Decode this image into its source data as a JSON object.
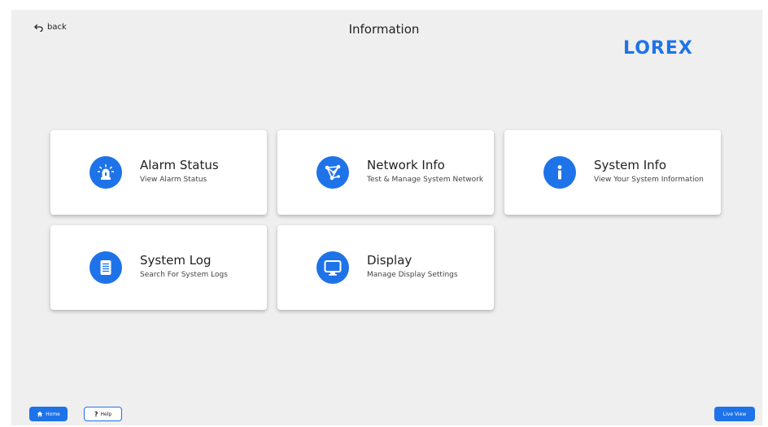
{
  "header": {
    "back_label": "back",
    "title": "Information",
    "logo_text": "LOREX"
  },
  "cards": [
    {
      "title": "Alarm Status",
      "subtitle": "View Alarm Status",
      "icon": "alarm-light-icon"
    },
    {
      "title": "Network Info",
      "subtitle": "Test & Manage System Network",
      "icon": "network-icon"
    },
    {
      "title": "System Info",
      "subtitle": "View Your System Information",
      "icon": "info-icon"
    },
    {
      "title": "System Log",
      "subtitle": "Search For System Logs",
      "icon": "document-icon"
    },
    {
      "title": "Display",
      "subtitle": "Manage Display Settings",
      "icon": "monitor-icon"
    }
  ],
  "footer": {
    "home_label": "Home",
    "help_label": "Help",
    "live_view_label": "Live View"
  },
  "colors": {
    "accent": "#1e73e8",
    "background": "#efefef",
    "card": "#ffffff"
  }
}
